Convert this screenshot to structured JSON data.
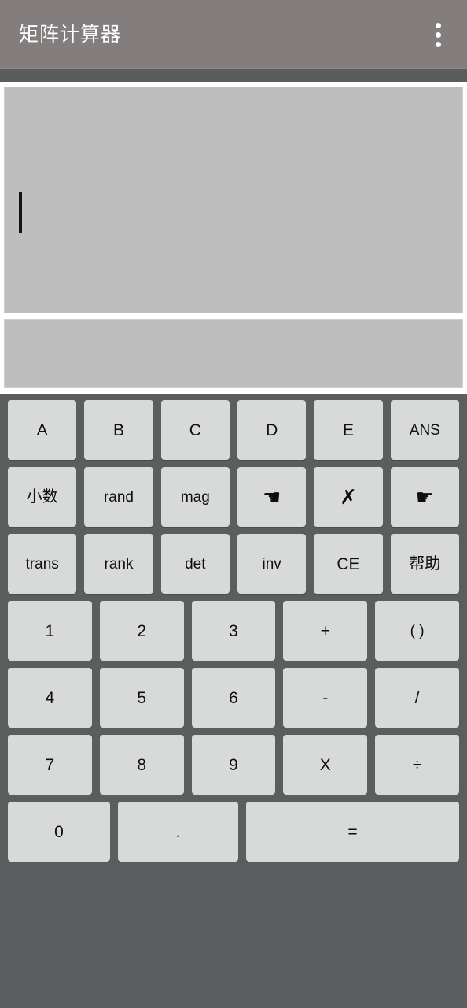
{
  "toolbar": {
    "title": "矩阵计算器",
    "overflow_icon": "more-vert-icon",
    "background_color": "#847d7d",
    "title_color": "#ffffff"
  },
  "display": {
    "input_value": "",
    "input_caret_visible": true,
    "result_value": "",
    "panel_color": "#bebebe"
  },
  "keypad": {
    "background_color": "#5a5e5e",
    "key_color": "#d8d9d9",
    "key_text_color": "#0e0e0e",
    "rows": [
      {
        "name": "matrix-vars-row",
        "keys": [
          {
            "label": "A",
            "name": "key-a"
          },
          {
            "label": "B",
            "name": "key-b"
          },
          {
            "label": "C",
            "name": "key-c"
          },
          {
            "label": "D",
            "name": "key-d"
          },
          {
            "label": "E",
            "name": "key-e"
          },
          {
            "label": "ANS",
            "name": "key-ans"
          }
        ]
      },
      {
        "name": "functions-row-1",
        "keys": [
          {
            "label": "小数",
            "name": "key-decimal-mode"
          },
          {
            "label": "rand",
            "name": "key-rand"
          },
          {
            "label": "mag",
            "name": "key-mag"
          },
          {
            "label": "☚",
            "name": "key-cursor-left"
          },
          {
            "label": "✗",
            "name": "key-backspace"
          },
          {
            "label": "☛",
            "name": "key-cursor-right"
          }
        ]
      },
      {
        "name": "functions-row-2",
        "keys": [
          {
            "label": "trans",
            "name": "key-transpose"
          },
          {
            "label": "rank",
            "name": "key-rank"
          },
          {
            "label": "det",
            "name": "key-determinant"
          },
          {
            "label": "inv",
            "name": "key-inverse"
          },
          {
            "label": "CE",
            "name": "key-clear-entry"
          },
          {
            "label": "帮助",
            "name": "key-help"
          }
        ]
      },
      {
        "name": "numeric-row-1",
        "keys": [
          {
            "label": "1",
            "name": "key-1"
          },
          {
            "label": "2",
            "name": "key-2"
          },
          {
            "label": "3",
            "name": "key-3"
          },
          {
            "label": "+",
            "name": "key-plus"
          },
          {
            "label": "( )",
            "name": "key-parentheses"
          }
        ]
      },
      {
        "name": "numeric-row-2",
        "keys": [
          {
            "label": "4",
            "name": "key-4"
          },
          {
            "label": "5",
            "name": "key-5"
          },
          {
            "label": "6",
            "name": "key-6"
          },
          {
            "label": "-",
            "name": "key-minus"
          },
          {
            "label": "/",
            "name": "key-slash"
          }
        ]
      },
      {
        "name": "numeric-row-3",
        "keys": [
          {
            "label": "7",
            "name": "key-7"
          },
          {
            "label": "8",
            "name": "key-8"
          },
          {
            "label": "9",
            "name": "key-9"
          },
          {
            "label": "X",
            "name": "key-multiply"
          },
          {
            "label": "÷",
            "name": "key-divide"
          }
        ]
      },
      {
        "name": "bottom-row",
        "keys": [
          {
            "label": "0",
            "name": "key-0"
          },
          {
            "label": ".",
            "name": "key-dot"
          },
          {
            "label": "=",
            "name": "key-equals"
          }
        ]
      }
    ]
  }
}
